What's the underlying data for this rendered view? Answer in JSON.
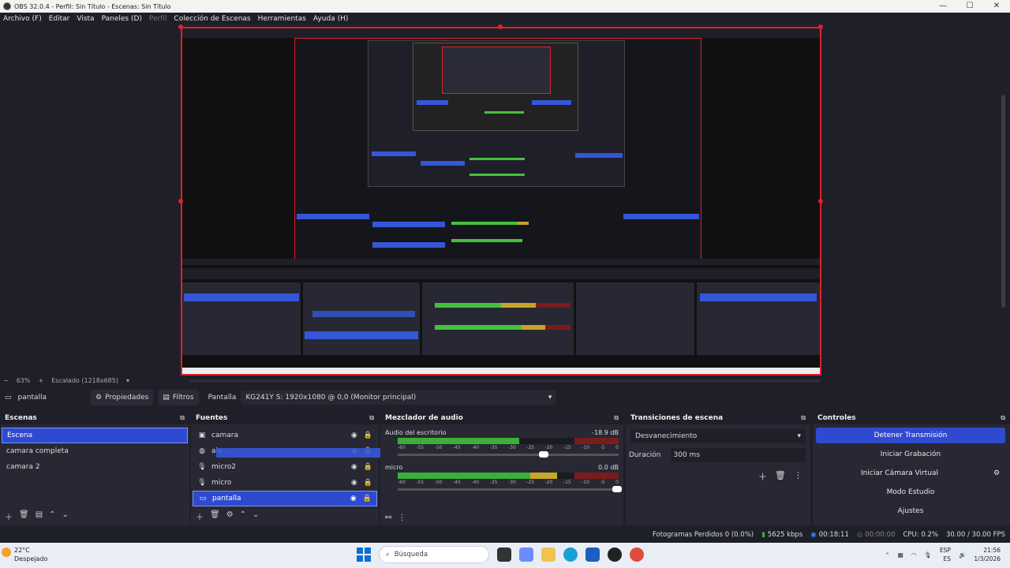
{
  "window": {
    "title": "OBS 32.0.4 - Perfil: Sin Título - Escenas: Sin Título",
    "buttons": [
      "—",
      "☐",
      "✕"
    ]
  },
  "menu": [
    "Archivo (F)",
    "Editar",
    "Vista",
    "Paneles (D)",
    "Perfil",
    "Colección de Escenas",
    "Herramientas",
    "Ayuda (H)"
  ],
  "zoom": {
    "percent": "63%",
    "minus": "−",
    "plus": "+",
    "scaled": "Escalado (1218x685)"
  },
  "source_toolbar": {
    "source_name": "pantalla",
    "properties": "Propiedades",
    "filters": "Filtros",
    "label": "Pantalla",
    "display_value": "KG241Y S: 1920x1080 @ 0,0 (Monitor principal)"
  },
  "scenes": {
    "header": "Escenas",
    "items": [
      "Escena",
      "camara completa",
      "camara 2"
    ],
    "selected": 0
  },
  "sources": {
    "header": "Fuentes",
    "items": [
      {
        "name": "camara",
        "icon": "camera-icon"
      },
      {
        "name": "ale...",
        "icon": "browser-icon"
      },
      {
        "name": "micro2",
        "icon": "mic-icon"
      },
      {
        "name": "micro",
        "icon": "mic-icon"
      },
      {
        "name": "pantalla",
        "icon": "display-icon"
      }
    ],
    "selected": 4
  },
  "mixer": {
    "header": "Mezclador de audio",
    "channels": [
      {
        "name": "Audio del escritorio",
        "db": "-18.9 dB",
        "level": 0.55
      },
      {
        "name": "micro",
        "db": "0.0 dB",
        "level": 0.72
      }
    ],
    "scale": [
      "-60",
      "-55",
      "-50",
      "-45",
      "-40",
      "-35",
      "-30",
      "-25",
      "-20",
      "-15",
      "-10",
      "-5",
      "0"
    ]
  },
  "transitions": {
    "header": "Transiciones de escena",
    "selected": "Desvanecimiento",
    "duration_label": "Duración",
    "duration_value": "300 ms"
  },
  "controls": {
    "header": "Controles",
    "buttons": [
      "Detener Transmisión",
      "Iniciar Grabación",
      "Iniciar Cámara Virtual",
      "Modo Estudio",
      "Ajustes"
    ]
  },
  "status": {
    "dropped": "Fotogramas Perdidos 0 (0.0%)",
    "bitrate": "5625 kbps",
    "stream_time": "00:18:11",
    "rec_time": "00:00:00",
    "cpu": "CPU: 0.2%",
    "fps": "30.00 / 30.00 FPS"
  },
  "taskbar": {
    "weather_temp": "22°C",
    "weather_desc": "Despejado",
    "search": "Búsqueda",
    "lang1": "ESP",
    "lang2": "ES",
    "time": "21:56",
    "date": "1/3/2026"
  },
  "colors": {
    "accent": "#2f4ad0",
    "record_red": "#e0202a",
    "meter_green": "#3ab03a"
  }
}
